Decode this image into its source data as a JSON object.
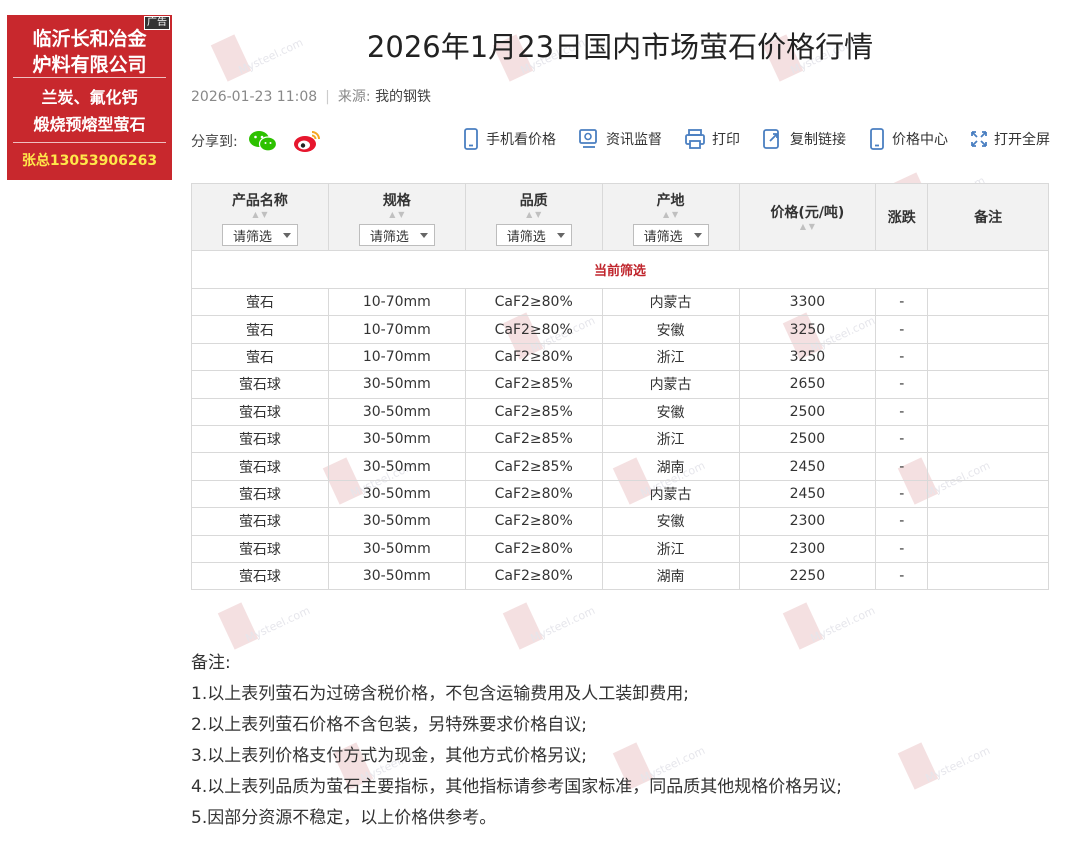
{
  "ad": {
    "tag": "广告",
    "line1": "临沂长和冶金",
    "line2": "炉料有限公司",
    "line3": "兰炭、氟化钙",
    "line4": "煅烧预熔型萤石",
    "line5": "张总13053906263"
  },
  "article": {
    "title": "2026年1月23日国内市场萤石价格行情",
    "datetime": "2026-01-23 11:08",
    "source_label": "来源:",
    "source": "我的钢铁"
  },
  "share": {
    "label": "分享到:",
    "icons": [
      "wechat-icon",
      "weibo-icon"
    ]
  },
  "tools": [
    {
      "label": "手机看价格",
      "icon": "mobile-icon"
    },
    {
      "label": "资讯监督",
      "icon": "monitor-icon"
    },
    {
      "label": "打印",
      "icon": "printer-icon"
    },
    {
      "label": "复制链接",
      "icon": "link-icon"
    },
    {
      "label": "价格中心",
      "icon": "price-center-icon"
    },
    {
      "label": "打开全屏",
      "icon": "fullscreen-icon"
    }
  ],
  "table": {
    "headers": [
      "产品名称",
      "规格",
      "品质",
      "产地",
      "价格(元/吨)",
      "涨跌",
      "备注"
    ],
    "filter_label": "请筛选",
    "current_filter": "当前筛选",
    "rows": [
      [
        "萤石",
        "10-70mm",
        "CaF2≥80%",
        "内蒙古",
        "3300",
        "-",
        ""
      ],
      [
        "萤石",
        "10-70mm",
        "CaF2≥80%",
        "安徽",
        "3250",
        "-",
        ""
      ],
      [
        "萤石",
        "10-70mm",
        "CaF2≥80%",
        "浙江",
        "3250",
        "-",
        ""
      ],
      [
        "萤石球",
        "30-50mm",
        "CaF2≥85%",
        "内蒙古",
        "2650",
        "-",
        ""
      ],
      [
        "萤石球",
        "30-50mm",
        "CaF2≥85%",
        "安徽",
        "2500",
        "-",
        ""
      ],
      [
        "萤石球",
        "30-50mm",
        "CaF2≥85%",
        "浙江",
        "2500",
        "-",
        ""
      ],
      [
        "萤石球",
        "30-50mm",
        "CaF2≥85%",
        "湖南",
        "2450",
        "-",
        ""
      ],
      [
        "萤石球",
        "30-50mm",
        "CaF2≥80%",
        "内蒙古",
        "2450",
        "-",
        ""
      ],
      [
        "萤石球",
        "30-50mm",
        "CaF2≥80%",
        "安徽",
        "2300",
        "-",
        ""
      ],
      [
        "萤石球",
        "30-50mm",
        "CaF2≥80%",
        "浙江",
        "2300",
        "-",
        ""
      ],
      [
        "萤石球",
        "30-50mm",
        "CaF2≥80%",
        "湖南",
        "2250",
        "-",
        ""
      ]
    ]
  },
  "notes": {
    "heading": "备注:",
    "items": [
      "1.以上表列萤石为过磅含税价格，不包含运输费用及人工装卸费用;",
      "2.以上表列萤石价格不含包装，另特殊要求价格自议;",
      "3.以上表列价格支付方式为现金，其他方式价格另议;",
      "4.以上表列品质为萤石主要指标，其他指标请参考国家标准，同品质其他规格价格另议;",
      "5.因部分资源不稳定，以上价格供参考。"
    ]
  },
  "colors": {
    "ad_bg": "#c8282d",
    "ad_phone": "#ffe84a",
    "current_filter": "#c0262d",
    "header_bg": "#f2f2f2",
    "wechat": "#2dc100",
    "weibo": "#e6162d",
    "tool_icon": "#4a7fc1"
  },
  "watermark": "Mysteel.com"
}
